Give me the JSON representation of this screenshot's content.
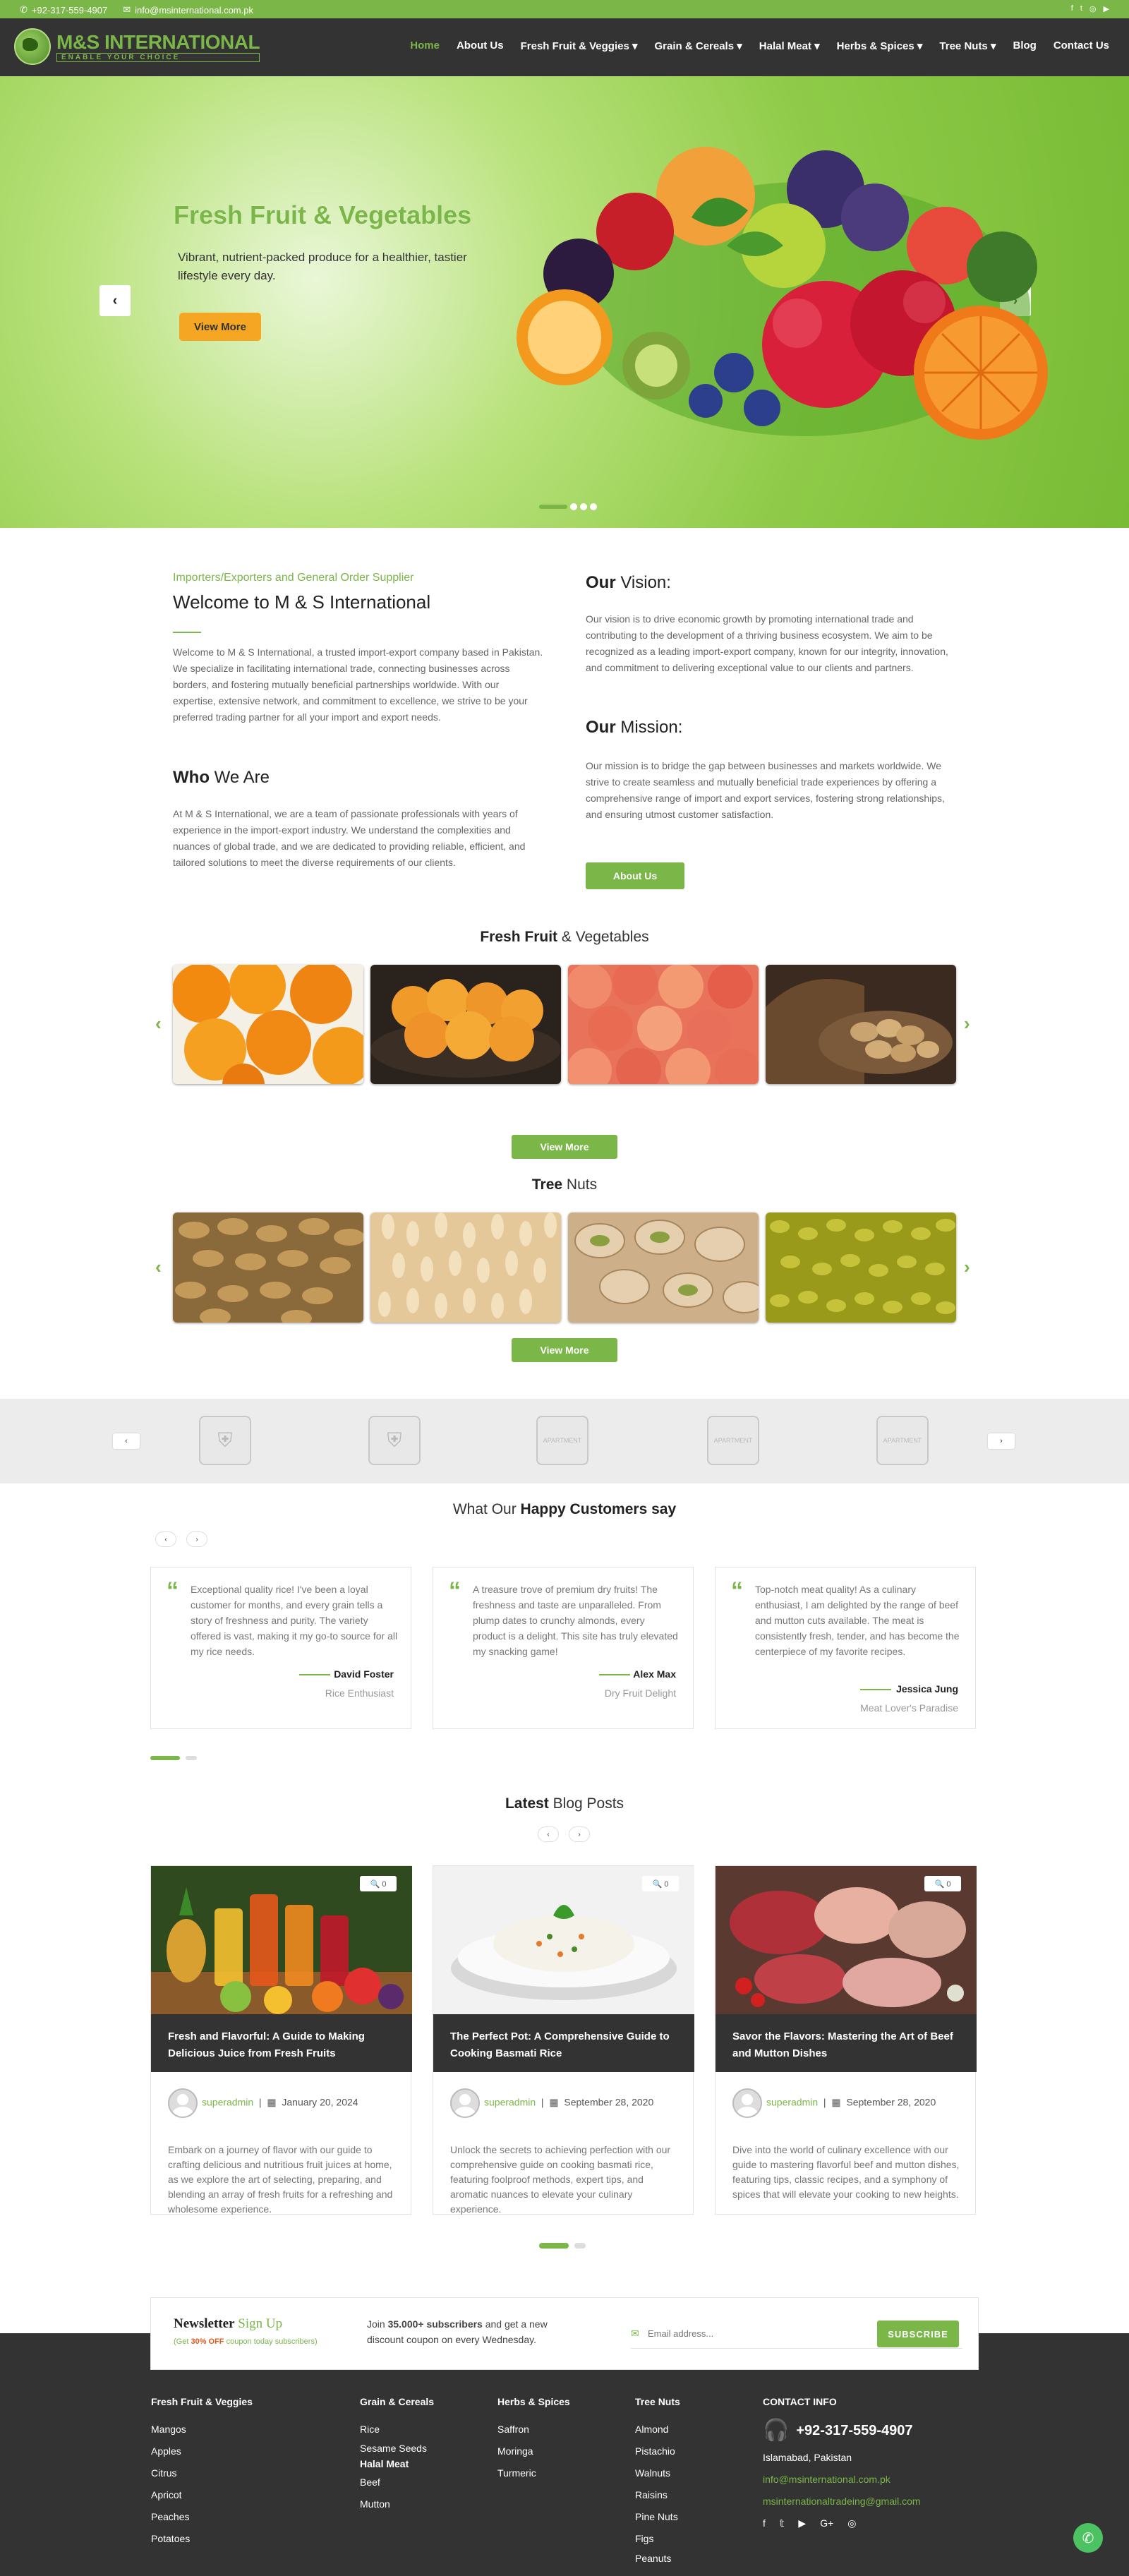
{
  "topbar": {
    "phone": "+92-317-559-4907",
    "email": "info@msinternational.com.pk",
    "social": [
      "facebook-icon",
      "twitter-icon",
      "instagram-icon",
      "youtube-icon"
    ]
  },
  "logo": {
    "title": "M&S INTERNATIONAL",
    "tagline": "ENABLE YOUR CHOICE"
  },
  "nav": [
    "Home",
    "About Us",
    "Fresh Fruit & Veggies ▾",
    "Grain & Cereals ▾",
    "Halal Meat ▾",
    "Herbs & Spices ▾",
    "Tree Nuts ▾",
    "Blog",
    "Contact Us"
  ],
  "hero": {
    "title": "Fresh Fruit & Vegetables",
    "text": "Vibrant, nutrient-packed produce for a healthier, tastier lifestyle every day.",
    "button": "View More",
    "prev": "‹",
    "next": "›"
  },
  "about": {
    "subtitle": "Importers/Exporters and General Order Supplier",
    "title": "Welcome to M & S International",
    "intro": "Welcome to M & S International, a trusted import-export company based in Pakistan. We specialize in facilitating international trade, connecting businesses across borders, and fostering mutually beneficial partnerships worldwide. With our expertise, extensive network, and commitment to excellence, we strive to be your preferred trading partner for all your import and export needs.",
    "who_bold": "Who",
    "who_rest": " We Are",
    "who_text": "At M & S International, we are a team of passionate professionals with years of experience in the import-export industry. We understand the complexities and nuances of global trade, and we are dedicated to providing reliable, efficient, and tailored solutions to meet the diverse requirements of our clients.",
    "vision_bold": "Our",
    "vision_rest": " Vision:",
    "vision_text": "Our vision is to drive economic growth by promoting international trade and contributing to the development of a thriving business ecosystem. We aim to be recognized as a leading import-export company, known for our integrity, innovation, and commitment to delivering exceptional value to our clients and partners.",
    "mission_bold": "Our",
    "mission_rest": " Mission:",
    "mission_text": "Our mission is to bridge the gap between businesses and markets worldwide. We strive to create seamless and mutually beneficial trade experiences by offering a comprehensive range of import and export services, fostering strong relationships, and ensuring utmost customer satisfaction.",
    "button": "About Us"
  },
  "fruit": {
    "title_bold": "Fresh Fruit",
    "title_rest": " & Vegetables",
    "button": "View More"
  },
  "nuts": {
    "title_bold": "Tree",
    "title_rest": " Nuts",
    "button": "View More"
  },
  "partners": {
    "labels": [
      "",
      "",
      "APARTMENT",
      "APARTMENT",
      "APARTMENT"
    ]
  },
  "testimonials": {
    "title_plain": "What Our ",
    "title_bold": "Happy Customers say",
    "items": [
      {
        "text": "Exceptional quality rice! I've been a loyal customer for months, and every grain tells a story of freshness and purity. The variety offered is vast, making it my go-to source for all my rice needs.",
        "name": "David Foster",
        "role": "Rice Enthusiast"
      },
      {
        "text": "A treasure trove of premium dry fruits! The freshness and taste are unparalleled. From plump dates to crunchy almonds, every product is a delight. This site has truly elevated my snacking game!",
        "name": "Alex Max",
        "role": "Dry Fruit Delight"
      },
      {
        "text": "Top-notch meat quality! As a culinary enthusiast, I am delighted by the range of beef and mutton cuts available. The meat is consistently fresh, tender, and has become the centerpiece of my favorite recipes.",
        "name": "Jessica Jung",
        "role": "Meat Lover's Paradise"
      }
    ]
  },
  "blog": {
    "title_bold": "Latest",
    "title_rest": " Blog Posts",
    "zoom": "🔍 0",
    "posts": [
      {
        "title": "Fresh and Flavorful: A Guide to Making Delicious Juice from Fresh Fruits",
        "author": "superadmin",
        "date": "January 20, 2024",
        "desc": "Embark on a journey of flavor with our guide to crafting delicious and nutritious fruit juices at home, as we explore the art of selecting, preparing, and blending an array of fresh fruits for a refreshing and wholesome experience."
      },
      {
        "title": "The Perfect Pot: A Comprehensive Guide to Cooking Basmati Rice",
        "author": "superadmin",
        "date": "September 28, 2020",
        "desc": "Unlock the secrets to achieving perfection with our comprehensive guide on cooking basmati rice, featuring foolproof methods, expert tips, and aromatic nuances to elevate your culinary experience."
      },
      {
        "title": "Savor the Flavors: Mastering the Art of Beef and Mutton Dishes",
        "author": "superadmin",
        "date": "September 28, 2020",
        "desc": "Dive into the world of culinary excellence with our guide to mastering flavorful beef and mutton dishes, featuring tips, classic recipes, and a symphony of spices that will elevate your cooking to new heights."
      }
    ]
  },
  "newsletter": {
    "title_bold": "Newsletter",
    "title_rest": " Sign Up",
    "sub_pre": "(Get ",
    "sub_bold": "30% OFF",
    "sub_post": " coupon today subscribers)",
    "join_pre": "Join ",
    "join_bold": "35.000+ subscribers",
    "join_post": " and get a new discount coupon on every Wednesday.",
    "placeholder": "Email address...",
    "button": "SUBSCRIBE"
  },
  "footer": {
    "col1": {
      "title": "Fresh Fruit & Veggies",
      "items": [
        "Mangos",
        "Apples",
        "Citrus",
        "Apricot",
        "Peaches",
        "Potatoes"
      ]
    },
    "col2": {
      "title": "Grain & Cereals",
      "items": [
        "Rice",
        "Sesame Seeds"
      ],
      "title2": "Halal Meat",
      "items2": [
        "Beef",
        "Mutton"
      ]
    },
    "col3": {
      "title": "Herbs & Spices",
      "items": [
        "Saffron",
        "Moringa",
        "Turmeric"
      ]
    },
    "col4": {
      "title": "Tree Nuts",
      "items": [
        "Almond",
        "Pistachio",
        "Walnuts",
        "Raisins",
        "Pine Nuts",
        "Figs",
        "Peanuts"
      ]
    },
    "contact": {
      "title": "CONTACT INFO",
      "phone": "+92-317-559-4907",
      "city": "Islamabad, Pakistan",
      "email1": "info@msinternational.com.pk",
      "email2": "msinternationaltradeing@gmail.com",
      "social": [
        "f",
        "🐦",
        "▶",
        "G+",
        "◎"
      ]
    }
  },
  "colors": {
    "brand": "#7ab648",
    "dark": "#333333",
    "accent": "#f5a623"
  }
}
